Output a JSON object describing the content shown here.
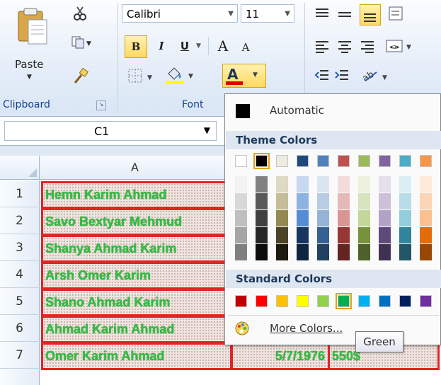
{
  "ribbon": {
    "paste_label": "Paste",
    "clipboard_label": "Clipboard",
    "font_group_label": "Font",
    "font_name": "Calibri",
    "font_size": "11",
    "bold": "B",
    "italic": "I",
    "underline": "U",
    "grow_font": "A",
    "shrink_font": "A",
    "font_color_letter": "A",
    "fill_color": "#ffff00",
    "font_color": "#e00000"
  },
  "formula_bar": {
    "name_box": "C1"
  },
  "grid": {
    "column_headers": [
      "A"
    ],
    "row_numbers": [
      "1",
      "2",
      "3",
      "4",
      "5",
      "6",
      "7"
    ],
    "cells": [
      "Hemn Karim Ahmad",
      "Savo Bextyar Mehmud",
      "Shanya Ahmad Karim",
      "Arsh Omer Karim",
      "Shano Ahmad Karim",
      "Ahmad Karim Ahmad",
      "Omer Karim Ahmad"
    ],
    "row7_date": "5/7/1976",
    "row7_amount": "550$"
  },
  "color_menu": {
    "automatic_label": "Automatic",
    "theme_colors_label": "Theme Colors",
    "standard_colors_label": "Standard Colors",
    "more_colors_label": "More Colors...",
    "tooltip": "Green",
    "theme_base": [
      "#ffffff",
      "#000000",
      "#eeece1",
      "#1f497d",
      "#4f81bd",
      "#c0504d",
      "#9bbb59",
      "#8064a2",
      "#4bacc6",
      "#f79646"
    ],
    "theme_tints": [
      [
        "#f2f2f2",
        "#808080",
        "#ddd9c3",
        "#c6d9f0",
        "#dbe5f1",
        "#f2dcdb",
        "#ebf1dd",
        "#e5e0ec",
        "#dbeef3",
        "#fdeada"
      ],
      [
        "#d8d8d8",
        "#595959",
        "#c4bd97",
        "#8db3e2",
        "#b8cce4",
        "#e5b9b7",
        "#d7e3bc",
        "#ccc1d9",
        "#b7dde8",
        "#fbd5b5"
      ],
      [
        "#bfbfbf",
        "#3f3f3f",
        "#938953",
        "#548dd4",
        "#95b3d7",
        "#d99694",
        "#c3d69b",
        "#b2a2c7",
        "#92cddc",
        "#fac08f"
      ],
      [
        "#a5a5a5",
        "#262626",
        "#494429",
        "#17365d",
        "#366092",
        "#953734",
        "#76923c",
        "#5f497a",
        "#31859b",
        "#e36c09"
      ],
      [
        "#7f7f7f",
        "#0c0c0c",
        "#1d1b10",
        "#0f243e",
        "#244061",
        "#632423",
        "#4f6128",
        "#3f3151",
        "#205867",
        "#974806"
      ]
    ],
    "standard": [
      "#c00000",
      "#ff0000",
      "#ffc000",
      "#ffff00",
      "#92d050",
      "#00b050",
      "#00b0f0",
      "#0070c0",
      "#002060",
      "#7030a0"
    ]
  }
}
